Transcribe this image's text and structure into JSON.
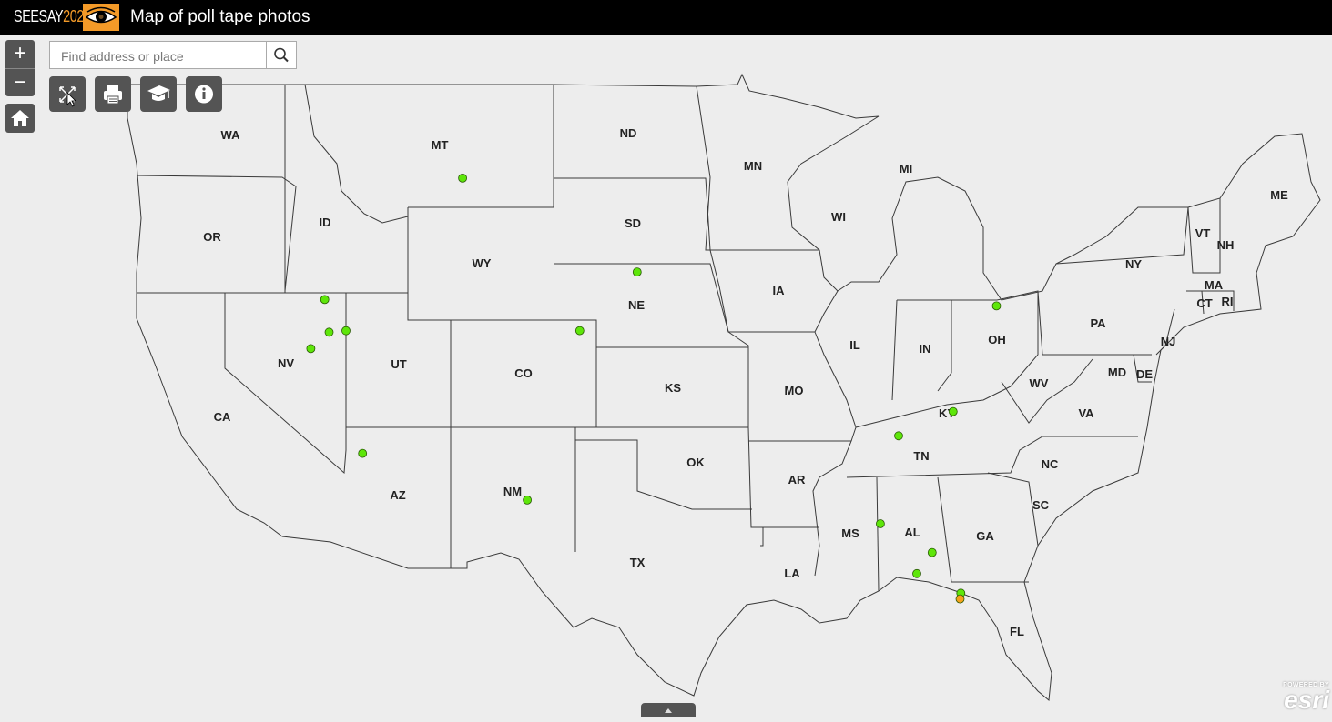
{
  "header": {
    "logo_text": "SEESAY",
    "logo_year": "2020",
    "logo_icon": "eye-icon",
    "title": "Map of poll tape photos"
  },
  "search": {
    "placeholder": "Find address or place",
    "value": ""
  },
  "zoom": {
    "in_label": "+",
    "out_label": "−"
  },
  "tools": [
    {
      "name": "select-tool",
      "icon": "select-arrows-icon"
    },
    {
      "name": "print-tool",
      "icon": "printer-icon"
    },
    {
      "name": "basemap-tool",
      "icon": "graduation-cap-icon"
    },
    {
      "name": "info-tool",
      "icon": "info-icon"
    }
  ],
  "esri": {
    "powered_by": "POWERED BY",
    "name": "esri"
  },
  "states": [
    {
      "abbr": "WA"
    },
    {
      "abbr": "OR"
    },
    {
      "abbr": "CA"
    },
    {
      "abbr": "NV"
    },
    {
      "abbr": "ID"
    },
    {
      "abbr": "MT"
    },
    {
      "abbr": "WY"
    },
    {
      "abbr": "UT"
    },
    {
      "abbr": "AZ"
    },
    {
      "abbr": "CO"
    },
    {
      "abbr": "NM"
    },
    {
      "abbr": "ND"
    },
    {
      "abbr": "SD"
    },
    {
      "abbr": "NE"
    },
    {
      "abbr": "KS"
    },
    {
      "abbr": "OK"
    },
    {
      "abbr": "TX"
    },
    {
      "abbr": "MN"
    },
    {
      "abbr": "IA"
    },
    {
      "abbr": "MO"
    },
    {
      "abbr": "AR"
    },
    {
      "abbr": "LA"
    },
    {
      "abbr": "WI"
    },
    {
      "abbr": "IL"
    },
    {
      "abbr": "MI"
    },
    {
      "abbr": "IN"
    },
    {
      "abbr": "OH"
    },
    {
      "abbr": "KY"
    },
    {
      "abbr": "TN"
    },
    {
      "abbr": "MS"
    },
    {
      "abbr": "AL"
    },
    {
      "abbr": "GA"
    },
    {
      "abbr": "FL"
    },
    {
      "abbr": "SC"
    },
    {
      "abbr": "NC"
    },
    {
      "abbr": "VA"
    },
    {
      "abbr": "WV"
    },
    {
      "abbr": "PA"
    },
    {
      "abbr": "NY"
    },
    {
      "abbr": "VT"
    },
    {
      "abbr": "NH"
    },
    {
      "abbr": "ME"
    },
    {
      "abbr": "MA"
    },
    {
      "abbr": "CT"
    },
    {
      "abbr": "RI"
    },
    {
      "abbr": "NJ"
    },
    {
      "abbr": "DE"
    },
    {
      "abbr": "MD"
    }
  ],
  "marker_colors": {
    "green": "#5ee60a",
    "orange": "#f5a21b"
  },
  "poll_tape_photos": [
    {
      "color": "green",
      "lon": -114.3,
      "lat": 48.2
    },
    {
      "color": "green",
      "lon": -100.1,
      "lat": 44.3
    },
    {
      "color": "green",
      "lon": -104.0,
      "lat": 41.0
    },
    {
      "color": "green",
      "lon": -122.2,
      "lat": 40.2
    },
    {
      "color": "green",
      "lon": -120.2,
      "lat": 38.9
    },
    {
      "color": "green",
      "lon": -121.3,
      "lat": 38.6
    },
    {
      "color": "green",
      "lon": -122.2,
      "lat": 37.5
    },
    {
      "color": "green",
      "lon": -117.2,
      "lat": 32.8
    },
    {
      "color": "green",
      "lon": -106.4,
      "lat": 31.8
    },
    {
      "color": "green",
      "lon": -74.2,
      "lat": 40.7
    },
    {
      "color": "green",
      "lon": -78.6,
      "lat": 35.7
    },
    {
      "color": "green",
      "lon": -82.4,
      "lat": 34.9
    },
    {
      "color": "green",
      "lon": -84.3,
      "lat": 30.4
    },
    {
      "color": "green",
      "lon": -81.4,
      "lat": 28.5
    },
    {
      "color": "green",
      "lon": -82.5,
      "lat": 27.5
    },
    {
      "color": "green",
      "lon": -80.1,
      "lat": 26.1
    },
    {
      "color": "orange",
      "lon": -80.2,
      "lat": 25.8
    }
  ]
}
